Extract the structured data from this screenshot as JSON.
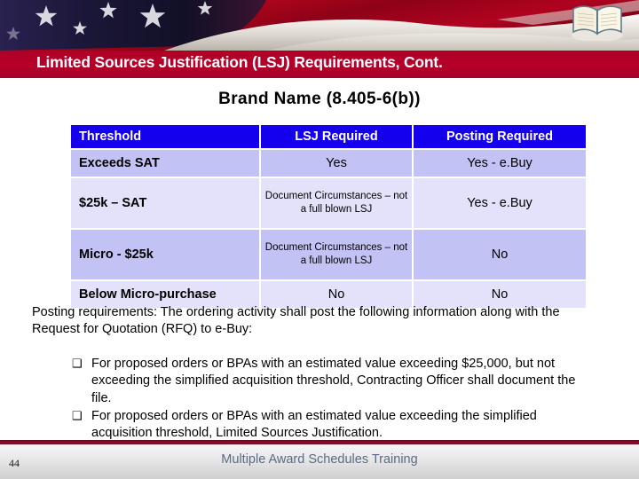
{
  "banner": {
    "book_icon": "open-book-icon",
    "flag_colors": {
      "navy": "#171a3a",
      "red": "#b0041f",
      "dark_red": "#6d0215",
      "white": "#f2 efe9"
    }
  },
  "header": {
    "title": "Limited Sources Justification (LSJ) Requirements, Cont.",
    "bar_color": "#b10028",
    "title_color": "#ffffff"
  },
  "subtitle": "Brand Name  (8.405-6(b))",
  "table": {
    "header_bg": "#1400ec",
    "header_text_color": "#ffffff",
    "row_shade_dark": "#c3c2f4",
    "row_shade_light": "#e3e2fa",
    "columns": [
      "Threshold",
      "LSJ Required",
      "Posting Required"
    ],
    "rows": [
      {
        "threshold": "Exceeds SAT",
        "lsj_required": "Yes",
        "posting_required": "Yes - e.Buy",
        "lsj_multiline": false
      },
      {
        "threshold": "$25k – SAT",
        "lsj_required": "Document Circumstances – not a full blown LSJ",
        "posting_required": "Yes - e.Buy",
        "lsj_multiline": true
      },
      {
        "threshold": "Micro - $25k",
        "lsj_required": "Document Circumstances – not a full blown LSJ",
        "posting_required": "No",
        "lsj_multiline": true
      },
      {
        "threshold": "Below Micro-purchase",
        "lsj_required": "No",
        "posting_required": "No",
        "lsj_multiline": false
      }
    ]
  },
  "body": {
    "posting_paragraph": "Posting requirements: The ordering activity shall post the following information along with the Request for Quotation (RFQ) to e-Buy:",
    "bullet_glyph": "❑",
    "bullets": [
      "For proposed orders or BPAs with an estimated value exceeding $25,000, but not exceeding the simplified acquisition threshold, Contracting Officer shall document the file.",
      "For proposed orders or BPAs with an estimated value exceeding the simplified acquisition threshold, Limited Sources Justification."
    ]
  },
  "footer": {
    "slide_number": "44",
    "title": "Multiple Award Schedules Training",
    "title_color": "#5a6b85",
    "rule_color": "#7d0b26"
  }
}
